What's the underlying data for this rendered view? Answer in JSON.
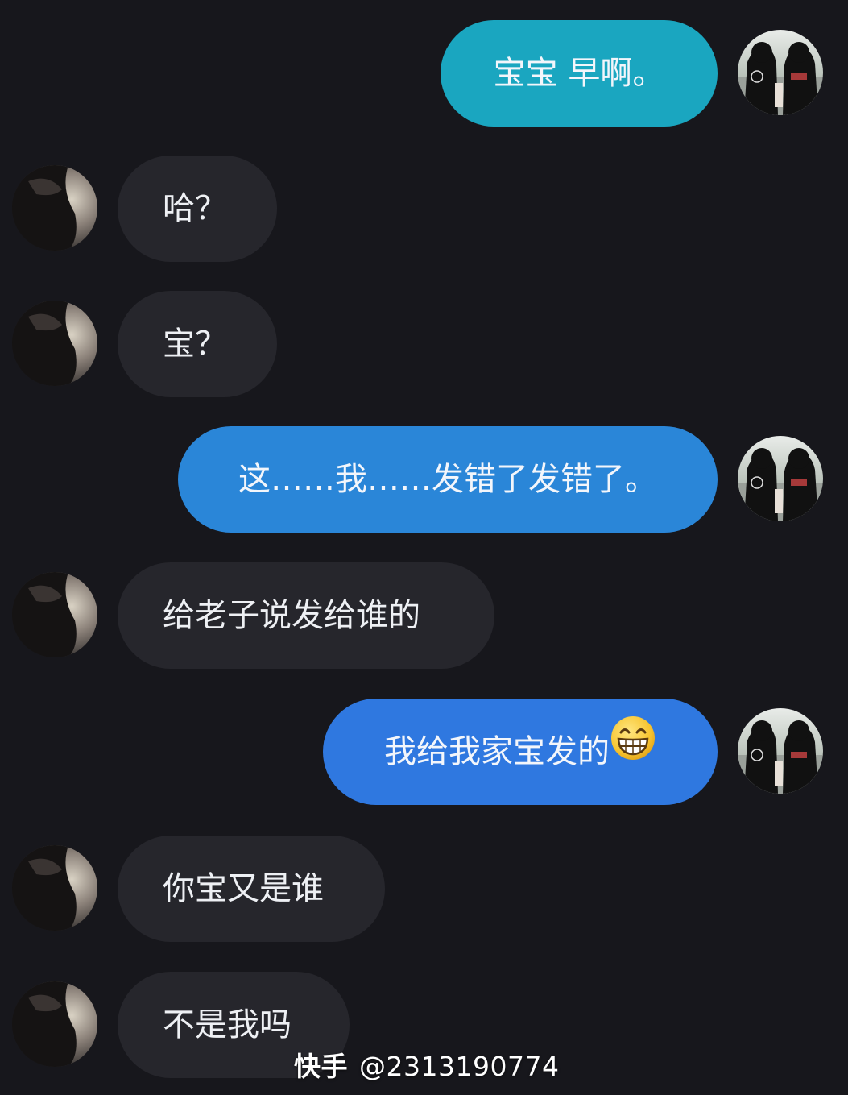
{
  "colors": {
    "background": "#17171c",
    "incoming_bubble": "#26262c",
    "outgoing_teal": "#1aa6c0",
    "outgoing_blue_mid": "#2a86d8",
    "outgoing_blue": "#2f78e0"
  },
  "messages": [
    {
      "side": "out",
      "text": "宝宝 早啊。"
    },
    {
      "side": "in",
      "text": "哈？"
    },
    {
      "side": "in",
      "text": "宝？"
    },
    {
      "side": "out",
      "text": "这……我……发错了发错了。"
    },
    {
      "side": "in",
      "text": "给老子说发给谁的"
    },
    {
      "side": "out",
      "text": "我给我家宝发的",
      "emoji": "grinning-face-with-smiling-eyes"
    },
    {
      "side": "in",
      "text": "你宝又是谁"
    },
    {
      "side": "in",
      "text": "不是我吗"
    }
  ],
  "avatars": {
    "self": "couple-holding-hands-avatar",
    "contact": "dark-portrait-avatar"
  },
  "watermark": {
    "brand": "快手",
    "handle": "@2313190774"
  }
}
